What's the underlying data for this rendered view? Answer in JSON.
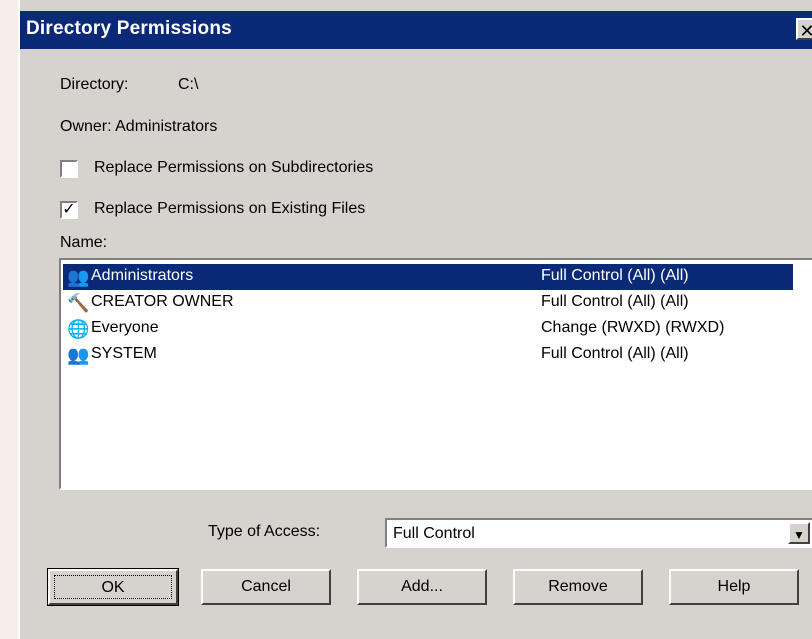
{
  "window": {
    "title": "Directory Permissions",
    "close_glyph": "✕"
  },
  "directory": {
    "label": "Directory:",
    "value": "C:\\"
  },
  "owner": {
    "label": "Owner: Administrators"
  },
  "options": [
    {
      "label": "Replace Permissions on Subdirectories",
      "checked": false
    },
    {
      "label": "Replace Permissions on Existing Files",
      "checked": true
    }
  ],
  "name_label": "Name:",
  "list": [
    {
      "name": "Administrators",
      "permission": "Full Control (All) (All)",
      "icon": "group-icon",
      "selected": true
    },
    {
      "name": "CREATOR OWNER",
      "permission": "Full Control (All) (All)",
      "icon": "creator-owner-icon",
      "selected": false
    },
    {
      "name": "Everyone",
      "permission": "Change (RWXD) (RWXD)",
      "icon": "globe-icon",
      "selected": false
    },
    {
      "name": "SYSTEM",
      "permission": "Full Control (All) (All)",
      "icon": "system-group-icon",
      "selected": false
    }
  ],
  "access": {
    "label": "Type of Access:",
    "value": "Full Control"
  },
  "buttons": {
    "ok": "OK",
    "cancel": "Cancel",
    "add": "Add...",
    "remove": "Remove",
    "help": "Help"
  },
  "colors": {
    "titlebar": "#0a2a78",
    "selection": "#0a2a78",
    "face": "#d6d3ce"
  }
}
